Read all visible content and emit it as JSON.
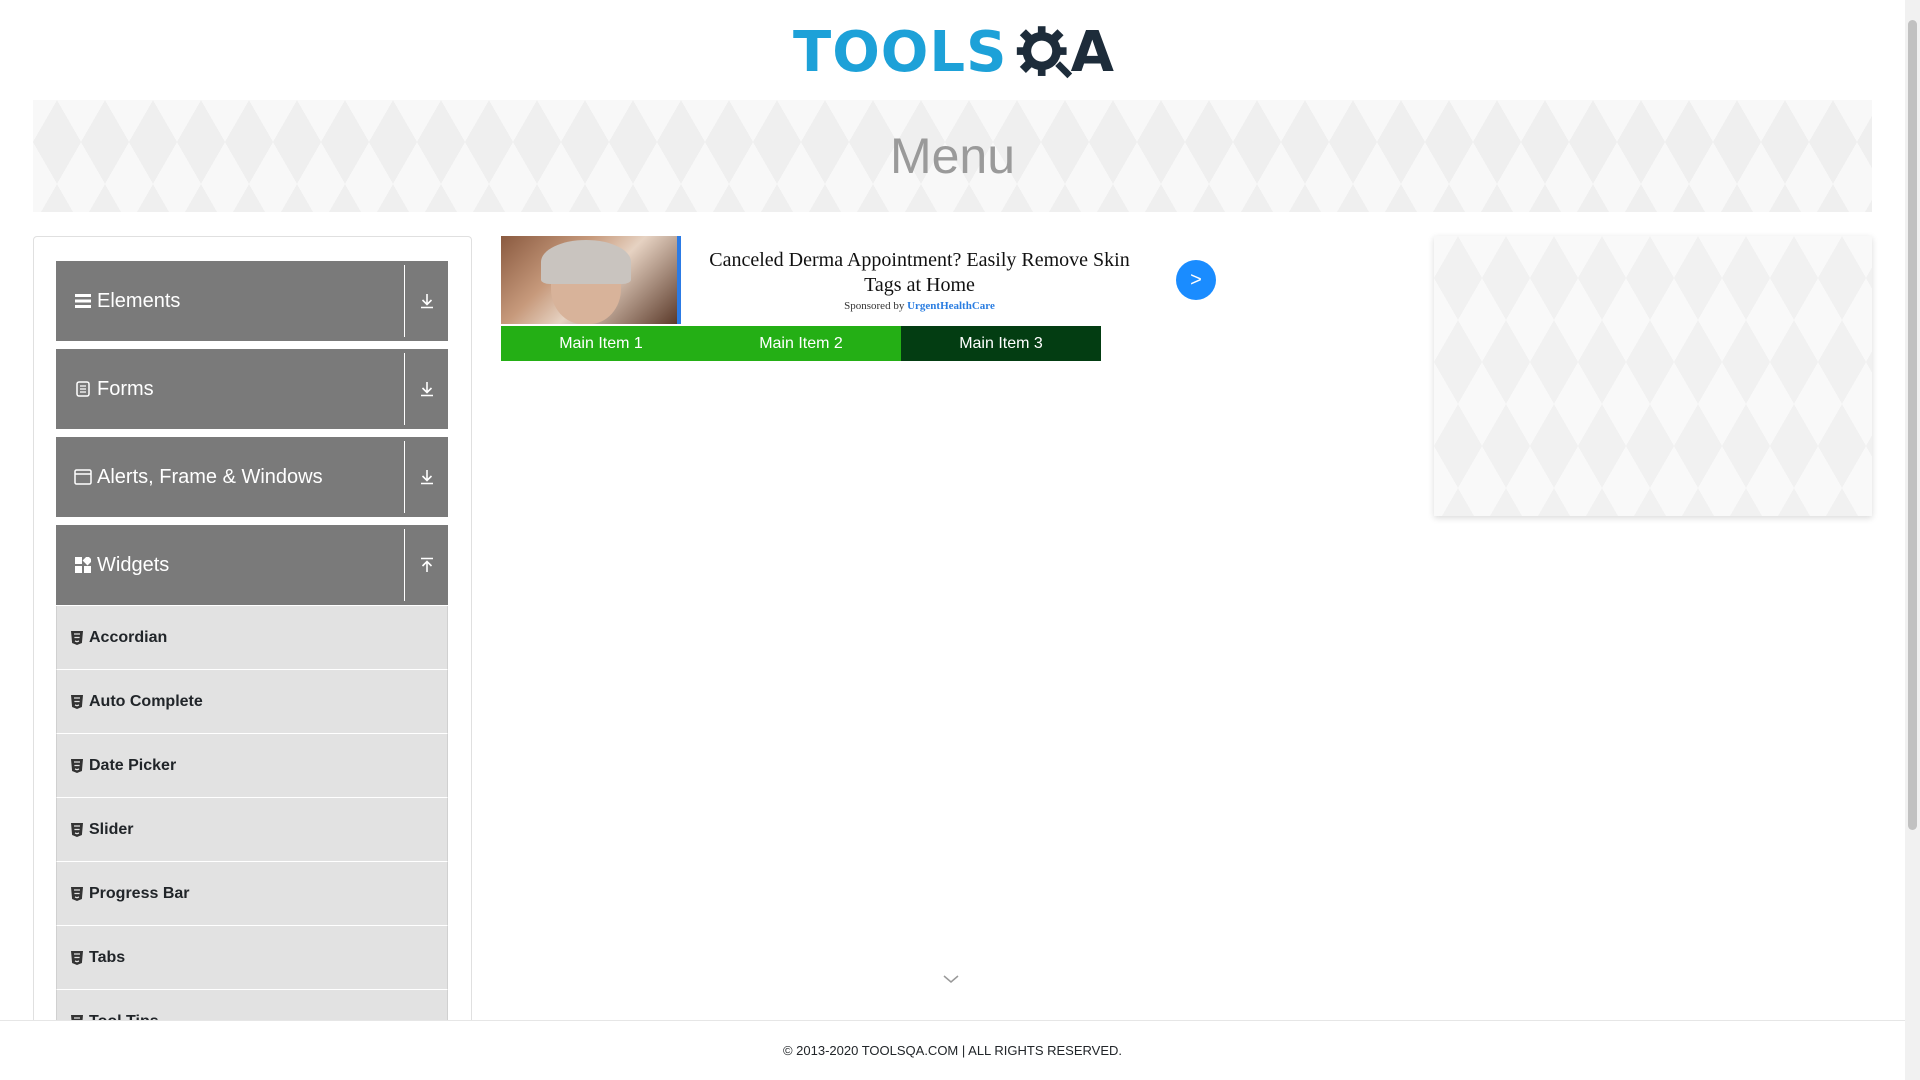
{
  "logo": {
    "part1": "TOOLS",
    "part2": "A",
    "colors": {
      "tools": "#1da1d8",
      "qa": "#1d2c3a"
    }
  },
  "banner": {
    "title": "Menu"
  },
  "sidebar": {
    "groups": [
      {
        "label": "Elements",
        "icon": "hamburger-icon",
        "toggle_icon": "download-arrow-icon"
      },
      {
        "label": "Forms",
        "icon": "document-icon",
        "toggle_icon": "download-arrow-icon"
      },
      {
        "label": "Alerts, Frame & Windows",
        "icon": "window-icon",
        "toggle_icon": "download-arrow-icon"
      },
      {
        "label": "Widgets",
        "icon": "widgets-icon",
        "toggle_icon": "upload-arrow-icon"
      }
    ],
    "items": [
      {
        "label": "Accordian",
        "icon": "html5-icon"
      },
      {
        "label": "Auto Complete",
        "icon": "html5-icon"
      },
      {
        "label": "Date Picker",
        "icon": "html5-icon"
      },
      {
        "label": "Slider",
        "icon": "html5-icon"
      },
      {
        "label": "Progress Bar",
        "icon": "html5-icon"
      },
      {
        "label": "Tabs",
        "icon": "html5-icon"
      },
      {
        "label": "Tool Tips",
        "icon": "html5-icon"
      }
    ]
  },
  "ad": {
    "headline": "Canceled Derma Appointment? Easily Remove Skin Tags at Home",
    "sponsored_prefix": "Sponsored by",
    "sponsor": "UrgentHealthCare",
    "go_label": ">"
  },
  "nav": {
    "items": [
      {
        "label": "Main Item 1"
      },
      {
        "label": "Main Item 2"
      },
      {
        "label": "Main Item 3"
      }
    ],
    "colors": {
      "item": "#24af15",
      "active": "#033d12"
    }
  },
  "footer": {
    "text": "© 2013-2020 TOOLSQA.COM | ALL RIGHTS RESERVED."
  }
}
